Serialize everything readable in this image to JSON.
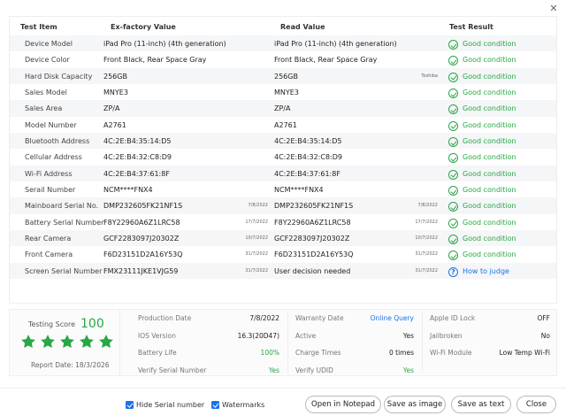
{
  "window": {
    "close_glyph": "✕"
  },
  "table": {
    "headers": [
      "Test Item",
      "Ex-factory Value",
      "Read Value",
      "Test Result"
    ],
    "rows": [
      {
        "item": "Device Model",
        "factory": "iPad Pro (11-inch) (4th generation)",
        "factory_date": "",
        "read": "iPad Pro (11-inch) (4th generation)",
        "read_date": "",
        "result": "Good condition",
        "status": "ok"
      },
      {
        "item": "Device Color",
        "factory": "Front Black, Rear Space Gray",
        "factory_date": "",
        "read": "Front Black, Rear Space Gray",
        "read_date": "",
        "result": "Good condition",
        "status": "ok"
      },
      {
        "item": "Hard Disk Capacity",
        "factory": "256GB",
        "factory_date": "",
        "read": "256GB",
        "read_date": "Toshiba",
        "result": "Good condition",
        "status": "ok"
      },
      {
        "item": "Sales Model",
        "factory": "MNYE3",
        "factory_date": "",
        "read": "MNYE3",
        "read_date": "",
        "result": "Good condition",
        "status": "ok"
      },
      {
        "item": "Sales Area",
        "factory": "ZP/A",
        "factory_date": "",
        "read": "ZP/A",
        "read_date": "",
        "result": "Good condition",
        "status": "ok"
      },
      {
        "item": "Model Number",
        "factory": "A2761",
        "factory_date": "",
        "read": "A2761",
        "read_date": "",
        "result": "Good condition",
        "status": "ok"
      },
      {
        "item": "Bluetooth Address",
        "factory": "4C:2E:B4:35:14:D5",
        "factory_date": "",
        "read": "4C:2E:B4:35:14:D5",
        "read_date": "",
        "result": "Good condition",
        "status": "ok"
      },
      {
        "item": "Cellular Address",
        "factory": "4C:2E:B4:32:C8:D9",
        "factory_date": "",
        "read": "4C:2E:B4:32:C8:D9",
        "read_date": "",
        "result": "Good condition",
        "status": "ok"
      },
      {
        "item": "Wi-Fi Address",
        "factory": "4C:2E:B4:37:61:8F",
        "factory_date": "",
        "read": "4C:2E:B4:37:61:8F",
        "read_date": "",
        "result": "Good condition",
        "status": "ok"
      },
      {
        "item": "Serail Number",
        "factory": "NCM****FNX4",
        "factory_date": "",
        "read": "NCM****FNX4",
        "read_date": "",
        "result": "Good condition",
        "status": "ok"
      },
      {
        "item": "Mainboard Serial No.",
        "factory": "DMP232605FK21NF1S",
        "factory_date": "7/8/2022",
        "read": "DMP232605FK21NF1S",
        "read_date": "7/8/2022",
        "result": "Good condition",
        "status": "ok"
      },
      {
        "item": "Battery Serial Number",
        "factory": "F8Y22960A6Z1LRC58",
        "factory_date": "17/7/2022",
        "read": "F8Y22960A6Z1LRC58",
        "read_date": "17/7/2022",
        "result": "Good condition",
        "status": "ok"
      },
      {
        "item": "Rear Camera",
        "factory": "GCF2283097J20302Z",
        "factory_date": "10/7/2022",
        "read": "GCF2283097J20302Z",
        "read_date": "10/7/2022",
        "result": "Good condition",
        "status": "ok"
      },
      {
        "item": "Front Camera",
        "factory": "F6D23151D2A16Y53Q",
        "factory_date": "31/7/2022",
        "read": "F6D23151D2A16Y53Q",
        "read_date": "31/7/2022",
        "result": "Good condition",
        "status": "ok"
      },
      {
        "item": "Screen Serial Number",
        "factory": "FMX23111JKE1VJG59",
        "factory_date": "31/7/2022",
        "read": "User decision needed",
        "read_date": "31/7/2022",
        "result": "How to judge",
        "status": "link"
      }
    ]
  },
  "summary": {
    "score_label": "Testing Score",
    "score": "100",
    "stars": 5,
    "report_date": "Report Date: 18/3/2026",
    "col1": [
      {
        "k": "Production Date",
        "v": "7/8/2022",
        "style": ""
      },
      {
        "k": "IOS Version",
        "v": "16.3(20D47)",
        "style": ""
      },
      {
        "k": "Battery Life",
        "v": "100%",
        "style": "green"
      },
      {
        "k": "Verify Serial Number",
        "v": "Yes",
        "style": "green"
      }
    ],
    "col2": [
      {
        "k": "Warranty Date",
        "v": "Online Query",
        "style": "blue"
      },
      {
        "k": "Active",
        "v": "Yes",
        "style": ""
      },
      {
        "k": "Charge Times",
        "v": "0 times",
        "style": ""
      },
      {
        "k": "Verify UDID",
        "v": "Yes",
        "style": "green"
      }
    ],
    "col3": [
      {
        "k": "Apple ID Lock",
        "v": "OFF",
        "style": ""
      },
      {
        "k": "Jailbroken",
        "v": "No",
        "style": ""
      },
      {
        "k": "Wi-Fi Module",
        "v": "Low Temp Wi-Fi",
        "style": ""
      }
    ]
  },
  "footer": {
    "hide_serial_label": "Hide Serial number",
    "watermarks_label": "Watermarks",
    "open_notepad": "Open in Notepad",
    "save_image": "Save as image",
    "save_text": "Save as text",
    "close": "Close"
  },
  "colors": {
    "good": "#28a745",
    "link": "#1a73e8",
    "checkbox": "#1a73e8"
  }
}
